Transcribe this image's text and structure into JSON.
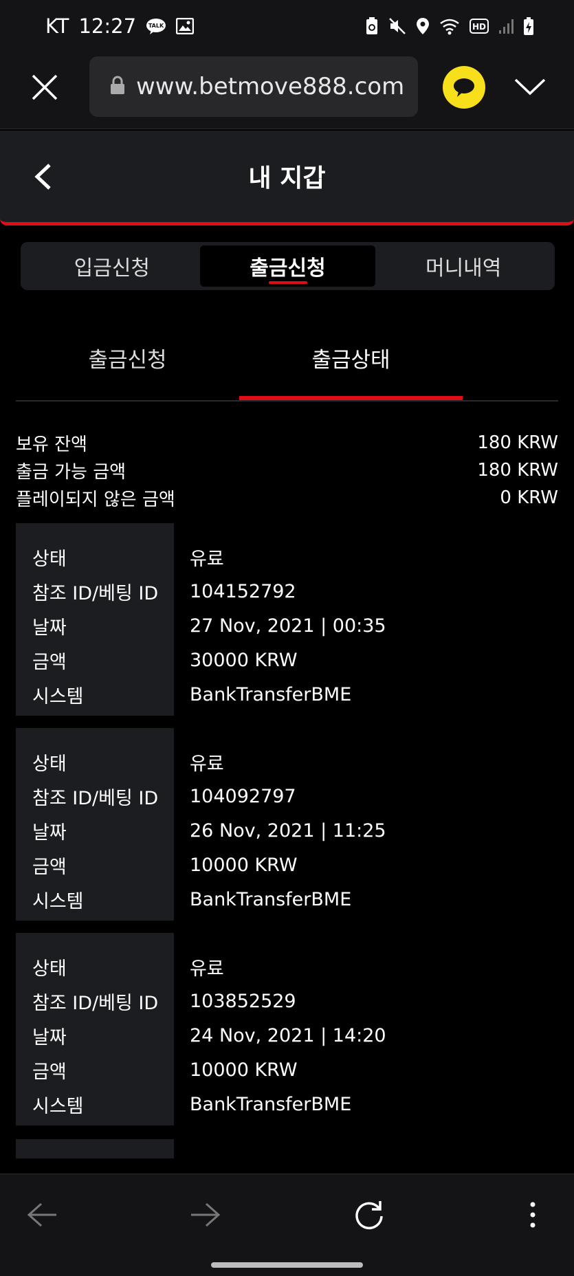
{
  "status_bar": {
    "carrier": "KT",
    "time": "12:27",
    "talk_icon_text": "TALK",
    "hd_text": "HD"
  },
  "browser": {
    "url": "www.betmove888.com"
  },
  "header": {
    "title": "내 지갑"
  },
  "main_tabs": [
    {
      "label": "입금신청"
    },
    {
      "label": "출금신청"
    },
    {
      "label": "머니내역"
    }
  ],
  "sub_tabs": [
    {
      "label": "출금신청"
    },
    {
      "label": "출금상태"
    }
  ],
  "balance": {
    "rows": [
      {
        "label": "보유 잔액",
        "value": "180 KRW"
      },
      {
        "label": "출금 가능 금액",
        "value": "180 KRW"
      },
      {
        "label": "플레이되지 않은 금액",
        "value": "0 KRW"
      }
    ]
  },
  "tx_labels": {
    "status": "상태",
    "ref": "참조 ID/베팅 ID",
    "date": "날짜",
    "amount": "금액",
    "system": "시스템"
  },
  "transactions": [
    {
      "status": "유료",
      "ref": "104152792",
      "date": "27 Nov, 2021 | 00:35",
      "amount": "30000 KRW",
      "system": "BankTransferBME"
    },
    {
      "status": "유료",
      "ref": "104092797",
      "date": "26 Nov, 2021 | 11:25",
      "amount": "10000 KRW",
      "system": "BankTransferBME"
    },
    {
      "status": "유료",
      "ref": "103852529",
      "date": "24 Nov, 2021 | 14:20",
      "amount": "10000 KRW",
      "system": "BankTransferBME"
    }
  ],
  "colors": {
    "accent": "#e00d16",
    "panel": "#1c1d21",
    "kakao": "#f7e01b"
  }
}
